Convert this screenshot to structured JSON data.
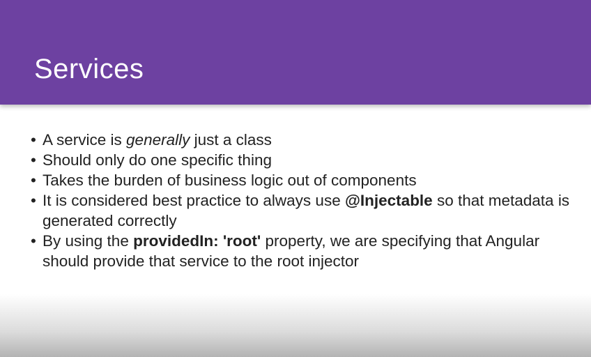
{
  "slide": {
    "title": "Services",
    "bullet_char": "•",
    "bullets": [
      {
        "parts": [
          "A service is ",
          "generally",
          " just a class"
        ]
      },
      {
        "parts": [
          "Should only do one specific thing"
        ]
      },
      {
        "parts": [
          "Takes the burden of business logic out of components"
        ]
      },
      {
        "parts": [
          "It is considered best practice to always use ",
          "@Injectable",
          " so that metadata is generated correctly"
        ]
      },
      {
        "parts": [
          "By using the ",
          "providedIn: 'root'",
          " property, we are specifying that Angular should provide that service to the root injector"
        ]
      }
    ]
  },
  "colors": {
    "header": "#6d41a1",
    "title_text": "#ffffff",
    "body_text": "#222222",
    "background": "#ffffff"
  }
}
